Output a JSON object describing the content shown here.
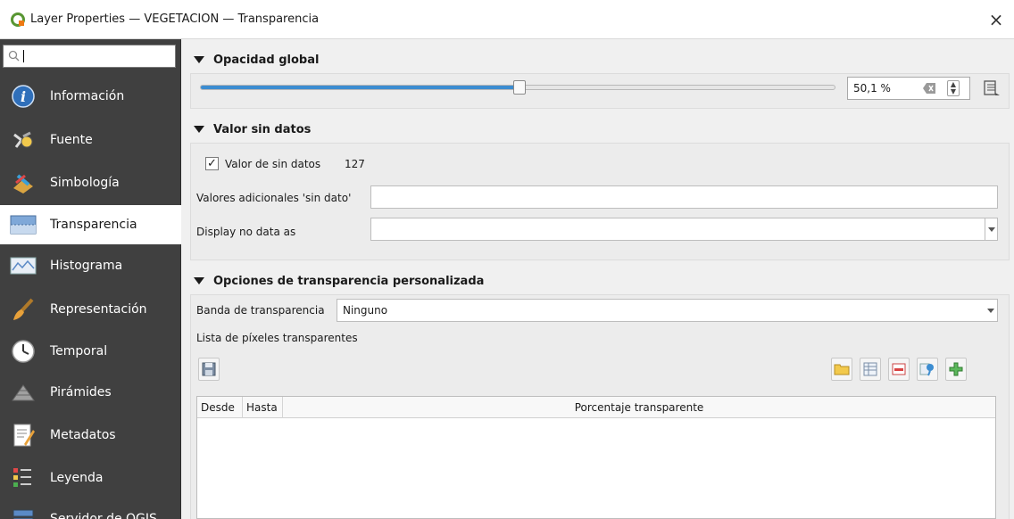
{
  "window": {
    "title": "Layer Properties — VEGETACION — Transparencia",
    "close_glyph": "×"
  },
  "sidebar": {
    "search": {
      "value": "",
      "placeholder": ""
    },
    "items": [
      {
        "label": "Información",
        "icon": "info-icon"
      },
      {
        "label": "Fuente",
        "icon": "source-icon"
      },
      {
        "label": "Simbología",
        "icon": "symbology-icon"
      },
      {
        "label": "Transparencia",
        "icon": "transparency-icon",
        "active": true
      },
      {
        "label": "Histograma",
        "icon": "histogram-icon"
      },
      {
        "label": "Representación",
        "icon": "rendering-icon"
      },
      {
        "label": "Temporal",
        "icon": "temporal-icon"
      },
      {
        "label": "Pirámides",
        "icon": "pyramids-icon"
      },
      {
        "label": "Metadatos",
        "icon": "metadata-icon"
      },
      {
        "label": "Leyenda",
        "icon": "legend-icon"
      },
      {
        "label": "Servidor de QGIS",
        "icon": "server-icon"
      }
    ]
  },
  "global_opacity": {
    "title": "Opacidad global",
    "value_text": "50,1 %",
    "value_fraction": 0.501
  },
  "no_data": {
    "title": "Valor sin datos",
    "checkbox_label": "Valor de sin datos",
    "checkbox_checked": true,
    "check_glyph": "✓",
    "value": "127",
    "additional_label": "Valores adicionales 'sin dato'",
    "additional_value": "",
    "display_label": "Display no data as",
    "display_value": ""
  },
  "custom_transparency": {
    "title": "Opciones de transparencia personalizada",
    "band_label": "Banda de transparencia",
    "band_value": "Ninguno",
    "pixel_list_label": "Lista de píxeles transparentes",
    "table": {
      "columns": [
        "Desde",
        "Hasta",
        "Porcentaje transparente"
      ],
      "rows": []
    }
  },
  "colors": {
    "sidebar_bg": "#404040",
    "slider_fill": "#3c8dd1",
    "active_item_bg": "#ffffff"
  }
}
